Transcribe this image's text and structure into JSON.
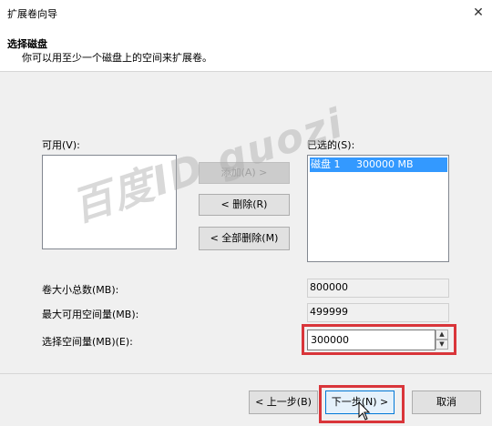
{
  "window": {
    "title": "扩展卷向导",
    "close_glyph": "✕"
  },
  "header": {
    "title": "选择磁盘",
    "subtitle": "你可以用至少一个磁盘上的空间来扩展卷。"
  },
  "available": {
    "label": "可用(V):"
  },
  "selected": {
    "label": "已选的(S):",
    "items": [
      "磁盘 1     300000 MB"
    ]
  },
  "buttons": {
    "add": "添加(A) >",
    "remove": "< 删除(R)",
    "remove_all": "< 全部删除(M)",
    "back": "< 上一步(B)",
    "next": "下一步(N) >",
    "cancel": "取消"
  },
  "fields": {
    "total_label": "卷大小总数(MB):",
    "total_value": "800000",
    "maxavail_label": "最大可用空间量(MB):",
    "maxavail_value": "499999",
    "select_label": "选择空间量(MB)(E):",
    "select_value": "300000"
  },
  "watermark": "百度ID guozi",
  "colors": {
    "highlight": "#d9353a",
    "selection": "#3399ff"
  }
}
